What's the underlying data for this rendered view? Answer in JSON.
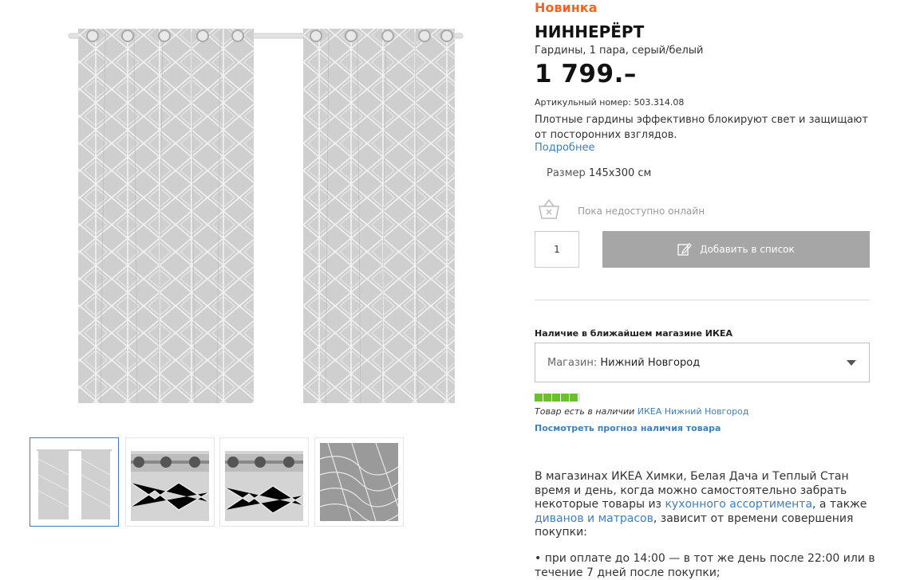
{
  "product": {
    "new_label": "Новинка",
    "name": "НИННЕРЁРТ",
    "description": "Гардины, 1 пара, серый/белый",
    "price": "1 799.–",
    "article_label": "Артикульный номер:",
    "article_number": "503.314.08",
    "details_text": "Плотные гардины эффективно блокируют свет и защищают от посторонних взглядов.",
    "more_link": "Подробнее",
    "size_label": "Размер",
    "size_value": "145x300 см"
  },
  "purchase": {
    "unavailable_text": "Пока недоступно онлайн",
    "quantity": "1",
    "add_to_list_label": "Добавить в список",
    "button_color": "#a6a6a6"
  },
  "availability": {
    "heading": "Наличие в ближайшем магазине ИКЕА",
    "store_label": "Магазин:",
    "store_value": "Нижний Новгород",
    "stock_level": 5,
    "stock_max": 5,
    "stock_color": "#6bc12a",
    "stock_text": "Товар есть в наличии",
    "stock_store_link": "ИКЕА Нижний Новгород",
    "forecast_link": "Посмотреть прогноз наличия товара"
  },
  "info": {
    "p1": "В магазинах ИКЕА Химки, Белая Дача и Теплый Стан время и день, когда можно самостоятельно забрать некоторые товары из",
    "link1": "кухонного ассортимента",
    "p2": ", а также",
    "link2": "диванов и матрасов",
    "p3": ", зависит от времени совершения покупки:",
    "bullet1": "• при оплате до 14:00 — в тот же день после 22:00 или в течение 7 дней после покупки;"
  },
  "gallery": {
    "thumbnails": [
      "curtains-full-view",
      "eyelet-detail",
      "eyelet-detail-alt",
      "fabric-pattern-closeup"
    ],
    "active_index": 0
  },
  "colors": {
    "accent_new": "#f26522",
    "link": "#3d7fbf"
  }
}
